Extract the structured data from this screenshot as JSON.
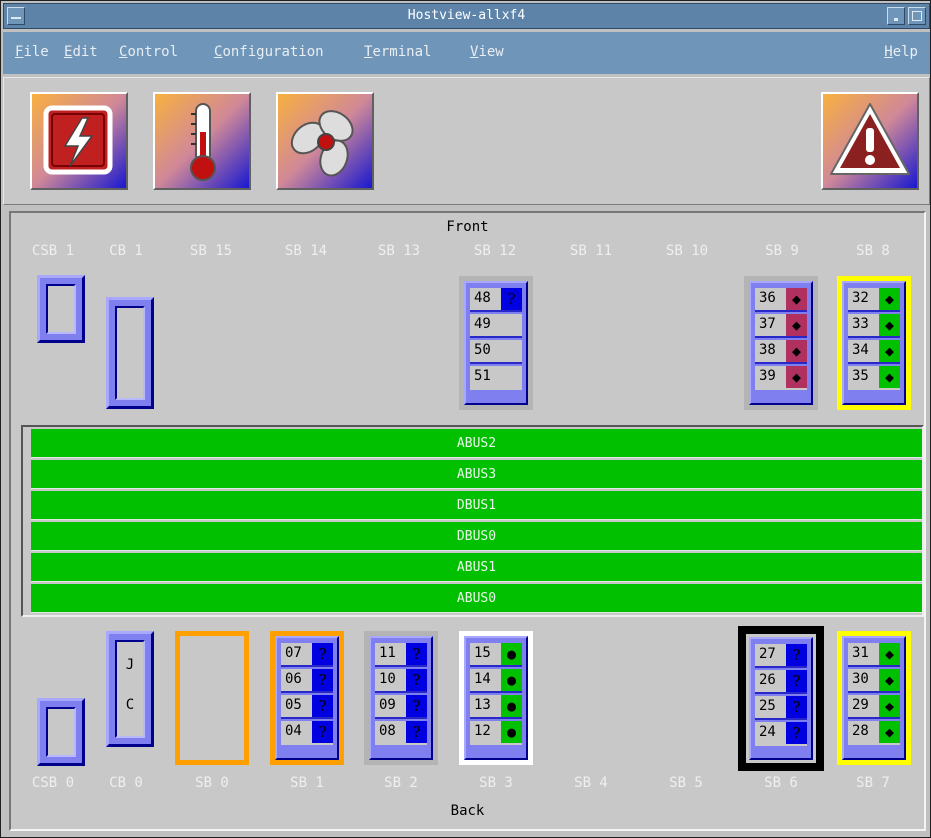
{
  "window": {
    "title": "Hostview-allxf4"
  },
  "menu": {
    "file": "File",
    "edit": "Edit",
    "control": "Control",
    "configuration": "Configuration",
    "terminal": "Terminal",
    "view": "View",
    "help": "Help"
  },
  "toolbar": {
    "buttons": [
      {
        "icon": "power-icon"
      },
      {
        "icon": "thermometer-icon"
      },
      {
        "icon": "fan-icon"
      },
      {
        "icon": "warning-icon"
      }
    ]
  },
  "colors": {
    "accent": "#5d84a8",
    "bus": "#00c000",
    "board_ok": "#00c000",
    "board_unknown": "#0000e0",
    "board_fault": "#b03060",
    "highlight_yellow": "#ffff00",
    "highlight_orange": "#ffa000",
    "highlight_black": "#000000",
    "highlight_white": "#ffffff"
  },
  "front": {
    "title": "Front",
    "labels": [
      "CSB 1",
      "CB 1",
      "SB 15",
      "SB 14",
      "SB 13",
      "SB 12",
      "SB 11",
      "SB 10",
      "SB 9",
      "SB 8"
    ],
    "sb12": {
      "boards": [
        {
          "num": "48",
          "status": "?"
        },
        {
          "num": "49",
          "status": ""
        },
        {
          "num": "50",
          "status": ""
        },
        {
          "num": "51",
          "status": ""
        }
      ]
    },
    "sb9": {
      "boards": [
        {
          "num": "36",
          "status": "◆"
        },
        {
          "num": "37",
          "status": "◆"
        },
        {
          "num": "38",
          "status": "◆"
        },
        {
          "num": "39",
          "status": "◆"
        }
      ]
    },
    "sb8": {
      "boards": [
        {
          "num": "32",
          "status": "◆"
        },
        {
          "num": "33",
          "status": "◆"
        },
        {
          "num": "34",
          "status": "◆"
        },
        {
          "num": "35",
          "status": "◆"
        }
      ]
    }
  },
  "buses": [
    "ABUS2",
    "ABUS3",
    "DBUS1",
    "DBUS0",
    "ABUS1",
    "ABUS0"
  ],
  "back": {
    "title": "Back",
    "labels": [
      "CSB 0",
      "CB 0",
      "SB 0",
      "SB 1",
      "SB 2",
      "SB 3",
      "SB 4",
      "SB 5",
      "SB 6",
      "SB 7"
    ],
    "cb0": {
      "top": "J",
      "bottom": "C"
    },
    "sb1": {
      "boards": [
        {
          "num": "07",
          "status": "?"
        },
        {
          "num": "06",
          "status": "?"
        },
        {
          "num": "05",
          "status": "?"
        },
        {
          "num": "04",
          "status": "?"
        }
      ]
    },
    "sb2": {
      "boards": [
        {
          "num": "11",
          "status": "?"
        },
        {
          "num": "10",
          "status": "?"
        },
        {
          "num": "09",
          "status": "?"
        },
        {
          "num": "08",
          "status": "?"
        }
      ]
    },
    "sb3": {
      "boards": [
        {
          "num": "15",
          "status": "●"
        },
        {
          "num": "14",
          "status": "●"
        },
        {
          "num": "13",
          "status": "●"
        },
        {
          "num": "12",
          "status": "●"
        }
      ]
    },
    "sb6": {
      "boards": [
        {
          "num": "27",
          "status": "?"
        },
        {
          "num": "26",
          "status": "?"
        },
        {
          "num": "25",
          "status": "?"
        },
        {
          "num": "24",
          "status": "?"
        }
      ]
    },
    "sb7": {
      "boards": [
        {
          "num": "31",
          "status": "◆"
        },
        {
          "num": "30",
          "status": "◆"
        },
        {
          "num": "29",
          "status": "◆"
        },
        {
          "num": "28",
          "status": "◆"
        }
      ]
    }
  }
}
